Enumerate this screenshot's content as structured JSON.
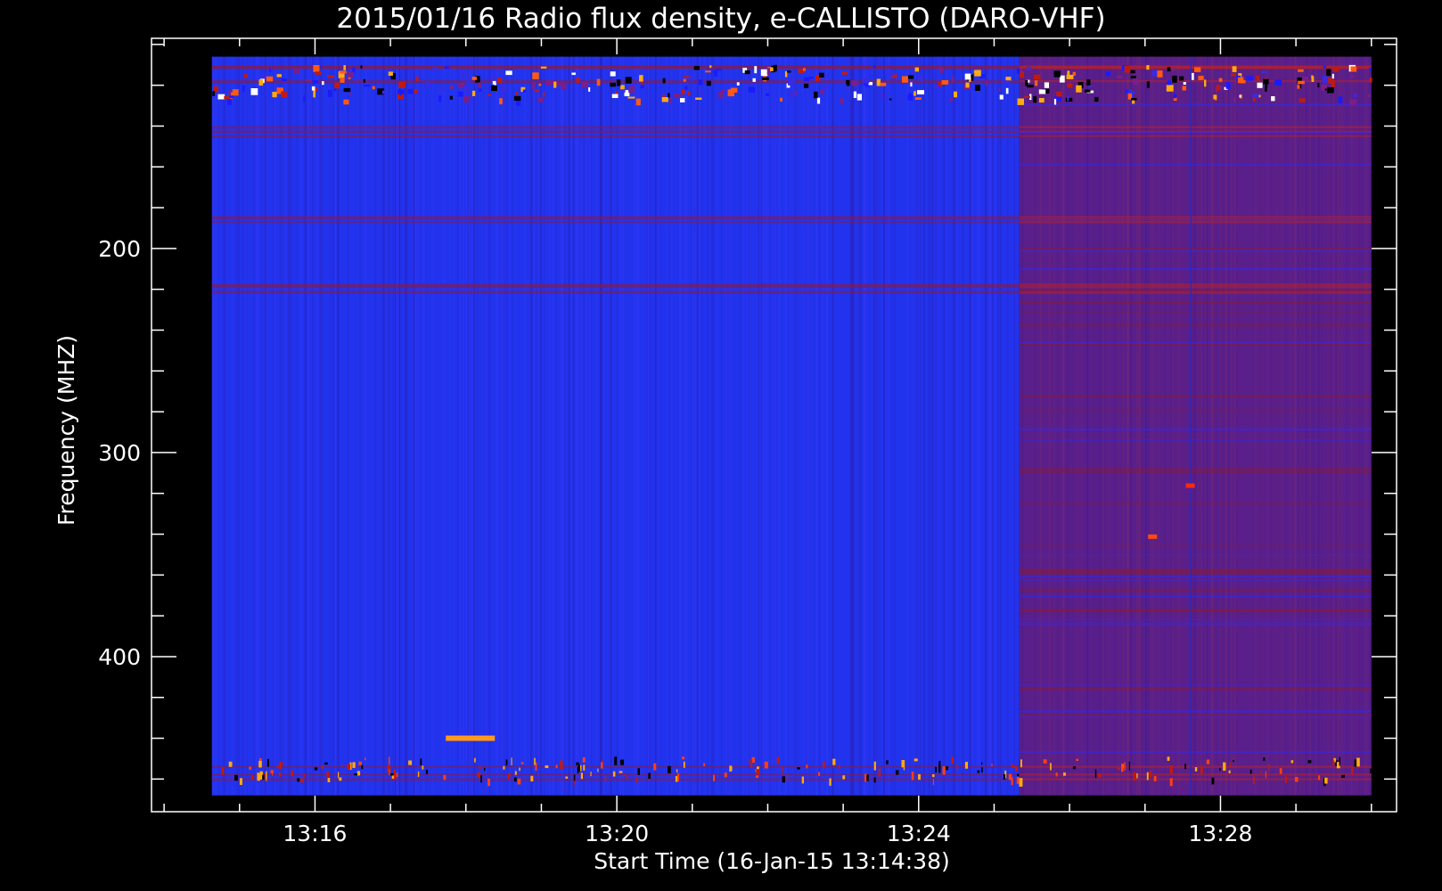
{
  "chart_data": {
    "type": "heatmap",
    "title": "2015/01/16  Radio flux density, e-CALLISTO (DARO-VHF)",
    "xlabel": "Start Time (16-Jan-15 13:14:38)",
    "ylabel": "Frequency (MHZ)",
    "x_unit": "time (hh:mm)",
    "y_unit": "MHz",
    "xlim": [
      "13:13:50",
      "13:30:20"
    ],
    "ylim": [
      476,
      97
    ],
    "data_xrange": [
      "13:14:38",
      "13:30:00"
    ],
    "data_yrange": [
      106,
      468
    ],
    "x_major_ticks": [
      {
        "time": "13:16",
        "label": "13:16"
      },
      {
        "time": "13:20",
        "label": "13:20"
      },
      {
        "time": "13:24",
        "label": "13:24"
      },
      {
        "time": "13:28",
        "label": "13:28"
      }
    ],
    "y_major_ticks": [
      {
        "value": 200,
        "label": "200"
      },
      {
        "value": 300,
        "label": "300"
      },
      {
        "value": 400,
        "label": "400"
      }
    ],
    "colormap": [
      "#000000",
      "#1a1aff",
      "#3a2ae0",
      "#7a1e8a",
      "#c01a10",
      "#ff5a10",
      "#ffaa10",
      "#ffffff"
    ],
    "regions": [
      {
        "time_start": "13:14:38",
        "time_end": "13:25:20",
        "level": "low",
        "color": "#2233ee"
      },
      {
        "time_start": "13:25:20",
        "time_end": "13:30:00",
        "level": "elevated",
        "color": "#5a1f8a"
      }
    ],
    "noise_bands_mhz": [
      [
        110,
        127
      ],
      [
        140,
        150
      ],
      [
        183,
        187
      ],
      [
        215,
        221
      ],
      [
        449,
        460
      ]
    ],
    "features": [
      {
        "type": "burst",
        "time": "13:17:44",
        "time_end": "13:18:23",
        "mhz": 440,
        "color": "#ff9a1a"
      },
      {
        "type": "spot",
        "time": "13:27:06",
        "mhz": 341,
        "color": "#ff4a10"
      },
      {
        "type": "spot",
        "time": "13:27:36",
        "mhz": 316,
        "color": "#ff2a10"
      }
    ]
  }
}
